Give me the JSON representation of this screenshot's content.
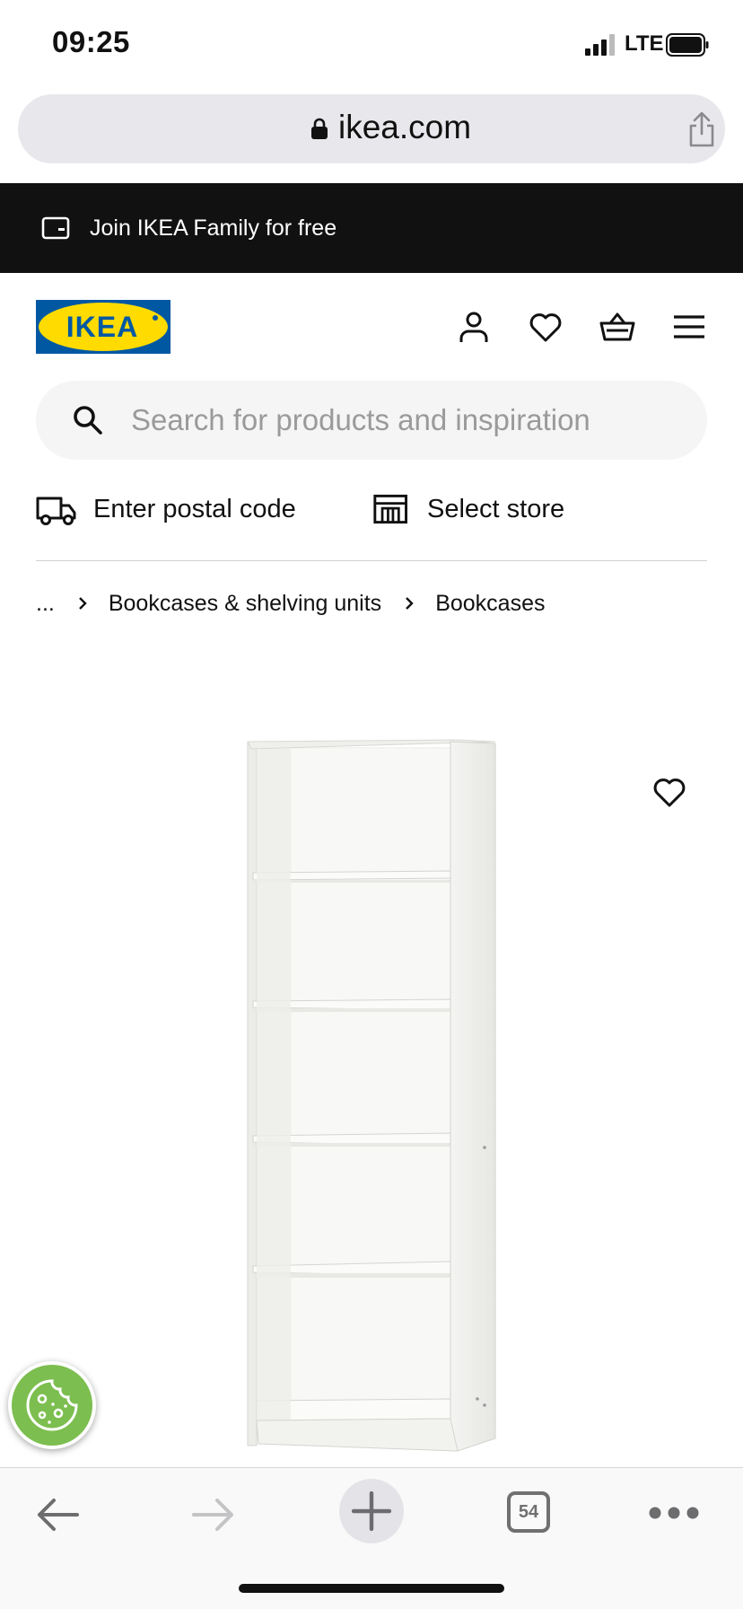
{
  "status_bar": {
    "time": "09:25",
    "network": "LTE"
  },
  "browser": {
    "domain": "ikea.com",
    "open_tabs": "54"
  },
  "promo": {
    "text": "Join IKEA Family for free"
  },
  "header": {
    "logo_text": "IKEA",
    "icons": [
      "account-icon",
      "heart-icon",
      "basket-icon",
      "hamburger-menu-icon"
    ]
  },
  "search": {
    "placeholder": "Search for products and inspiration"
  },
  "location": {
    "postal_label": "Enter postal code",
    "store_label": "Select store"
  },
  "breadcrumb": {
    "ellipsis": "...",
    "items": [
      "Bookcases & shelving units",
      "Bookcases"
    ]
  },
  "colors": {
    "ikea_blue": "#0058a3",
    "ikea_yellow": "#ffdb00",
    "promo_bg": "#111111",
    "cookie_green": "#7cbe4f"
  }
}
